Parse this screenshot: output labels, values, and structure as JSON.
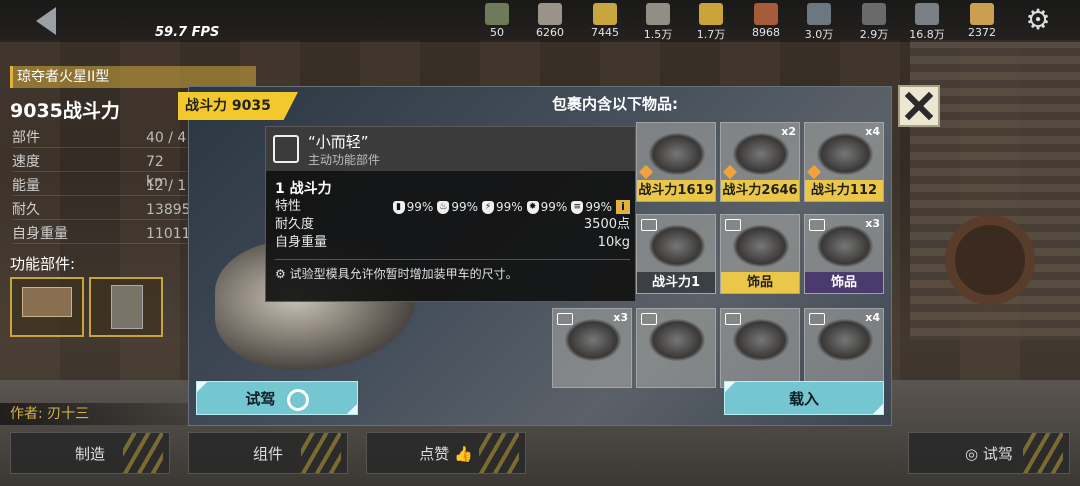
{
  "fps": "59.7 FPS",
  "resources": [
    {
      "icon": "rifle-icon",
      "value": "50",
      "color": "#6f7a5a"
    },
    {
      "icon": "wrench-icon",
      "value": "6260",
      "color": "#9a9488"
    },
    {
      "icon": "battery-icon",
      "value": "7445",
      "color": "#c7a640"
    },
    {
      "icon": "fuel-canister-icon",
      "value": "1.5万",
      "color": "#8f8f86"
    },
    {
      "icon": "spool-icon",
      "value": "1.7万",
      "color": "#c9a43a"
    },
    {
      "icon": "copper-bar-icon",
      "value": "8968",
      "color": "#a65b3a"
    },
    {
      "icon": "wire-coil-icon",
      "value": "3.0万",
      "color": "#6c7880"
    },
    {
      "icon": "plastic-icon",
      "value": "2.9万",
      "color": "#6a6a6a"
    },
    {
      "icon": "electronics-icon",
      "value": "16.8万",
      "color": "#7a7f86"
    },
    {
      "icon": "coin-icon",
      "value": "2372",
      "color": "#caa050"
    }
  ],
  "vehicle": {
    "name": "琼夺者火星II型",
    "power": "9035战斗力",
    "stats": [
      {
        "label": "部件",
        "value": "40 / 4"
      },
      {
        "label": "速度",
        "value": "72 km"
      },
      {
        "label": "能量",
        "value": "12 / 1"
      },
      {
        "label": "耐久",
        "value": "13895"
      },
      {
        "label": "自身重量",
        "value": "11011"
      }
    ],
    "func_title": "功能部件:",
    "author": "作者: 刃十三"
  },
  "bottom_buttons": {
    "craft": "制造",
    "parts": "组件",
    "like": "点赞",
    "testdrive": "试驾"
  },
  "modal": {
    "power_tag": "战斗力 9035",
    "package_title": "包裹内含以下物品:",
    "testdrive_label": "试驾",
    "load_label": "载入",
    "items": [
      {
        "count": "",
        "label": "战斗力1619",
        "style": "gold",
        "diamond": true,
        "part_icon": false
      },
      {
        "count": "x2",
        "label": "战斗力2646",
        "style": "gold",
        "diamond": true,
        "part_icon": false
      },
      {
        "count": "x4",
        "label": "战斗力112",
        "style": "gold",
        "diamond": true,
        "part_icon": false
      },
      {
        "count": "",
        "label": "战斗力1",
        "style": "grey",
        "diamond": false,
        "part_icon": true
      },
      {
        "count": "",
        "label": "饰品",
        "style": "gold",
        "diamond": false,
        "part_icon": true
      },
      {
        "count": "x3",
        "label": "饰品",
        "style": "purple",
        "diamond": false,
        "part_icon": true
      },
      {
        "count": "x3",
        "label": "",
        "style": "none",
        "diamond": false,
        "part_icon": true
      },
      {
        "count": "",
        "label": "",
        "style": "none",
        "diamond": false,
        "part_icon": true
      },
      {
        "count": "",
        "label": "",
        "style": "none",
        "diamond": false,
        "part_icon": true
      },
      {
        "count": "x4",
        "label": "",
        "style": "none",
        "diamond": false,
        "part_icon": true
      }
    ]
  },
  "tooltip": {
    "name": "“小而轻”",
    "type": "主动功能部件",
    "power": "1 战斗力",
    "traits_label": "特性",
    "traits": [
      {
        "icon": "shield-icon",
        "value": "99%"
      },
      {
        "icon": "fire-resist-icon",
        "value": "99%"
      },
      {
        "icon": "lightning-icon",
        "value": "99%"
      },
      {
        "icon": "explosion-icon",
        "value": "99%"
      },
      {
        "icon": "armor-icon",
        "value": "99%"
      }
    ],
    "durability_label": "耐久度",
    "durability_value": "3500点",
    "weight_label": "自身重量",
    "weight_value": "10kg",
    "description": "试验型模具允许你暂时增加装甲车的尺寸。"
  }
}
